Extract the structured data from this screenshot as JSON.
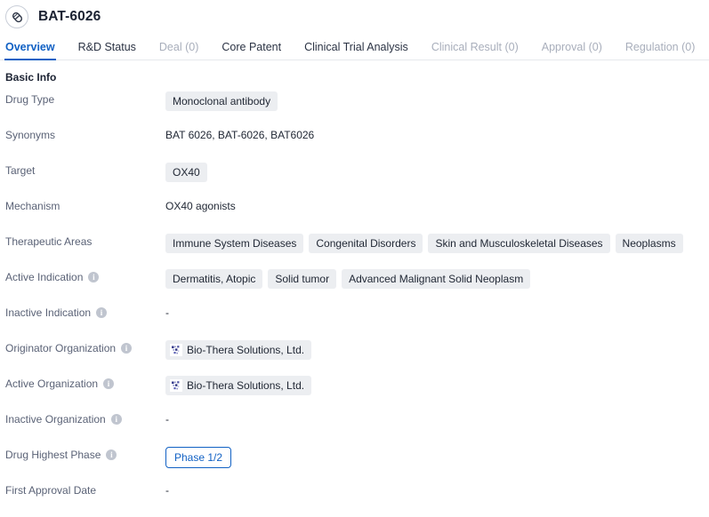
{
  "header": {
    "icon": "pill-capsule-icon",
    "title": "BAT-6026"
  },
  "tabs": [
    {
      "label": "Overview",
      "active": true,
      "muted": false
    },
    {
      "label": "R&D Status",
      "active": false,
      "muted": false
    },
    {
      "label": "Deal (0)",
      "active": false,
      "muted": true
    },
    {
      "label": "Core Patent",
      "active": false,
      "muted": false
    },
    {
      "label": "Clinical Trial Analysis",
      "active": false,
      "muted": false
    },
    {
      "label": "Clinical Result (0)",
      "active": false,
      "muted": true
    },
    {
      "label": "Approval (0)",
      "active": false,
      "muted": true
    },
    {
      "label": "Regulation (0)",
      "active": false,
      "muted": true
    }
  ],
  "section": {
    "title": "Basic Info"
  },
  "fields": {
    "drug_type": {
      "label": "Drug Type",
      "chips": [
        "Monoclonal antibody"
      ]
    },
    "synonyms": {
      "label": "Synonyms",
      "value": "BAT 6026,  BAT-6026,  BAT6026"
    },
    "target": {
      "label": "Target",
      "chips": [
        "OX40"
      ]
    },
    "mechanism": {
      "label": "Mechanism",
      "value": "OX40 agonists"
    },
    "therapeutic_areas": {
      "label": "Therapeutic Areas",
      "chips": [
        "Immune System Diseases",
        "Congenital Disorders",
        "Skin and Musculoskeletal Diseases",
        "Neoplasms"
      ]
    },
    "active_indication": {
      "label": "Active Indication",
      "has_info": true,
      "chips": [
        "Dermatitis, Atopic",
        "Solid tumor",
        "Advanced Malignant Solid Neoplasm"
      ]
    },
    "inactive_indication": {
      "label": "Inactive Indication",
      "has_info": true,
      "value": "-"
    },
    "originator_organization": {
      "label": "Originator Organization",
      "has_info": true,
      "chips": [
        "Bio-Thera Solutions, Ltd."
      ]
    },
    "active_organization": {
      "label": "Active Organization",
      "has_info": true,
      "chips": [
        "Bio-Thera Solutions, Ltd."
      ]
    },
    "inactive_organization": {
      "label": "Inactive Organization",
      "has_info": true,
      "value": "-"
    },
    "drug_highest_phase": {
      "label": "Drug Highest Phase",
      "has_info": true,
      "badge": "Phase 1/2"
    },
    "first_approval_date": {
      "label": "First Approval Date",
      "has_info": false,
      "value": "-"
    }
  },
  "icons": {
    "info": "i"
  },
  "colors": {
    "accent": "#1161c4",
    "chip_bg": "#eceef1",
    "label_text": "#5a6276",
    "muted_tab": "#a8aebb"
  }
}
